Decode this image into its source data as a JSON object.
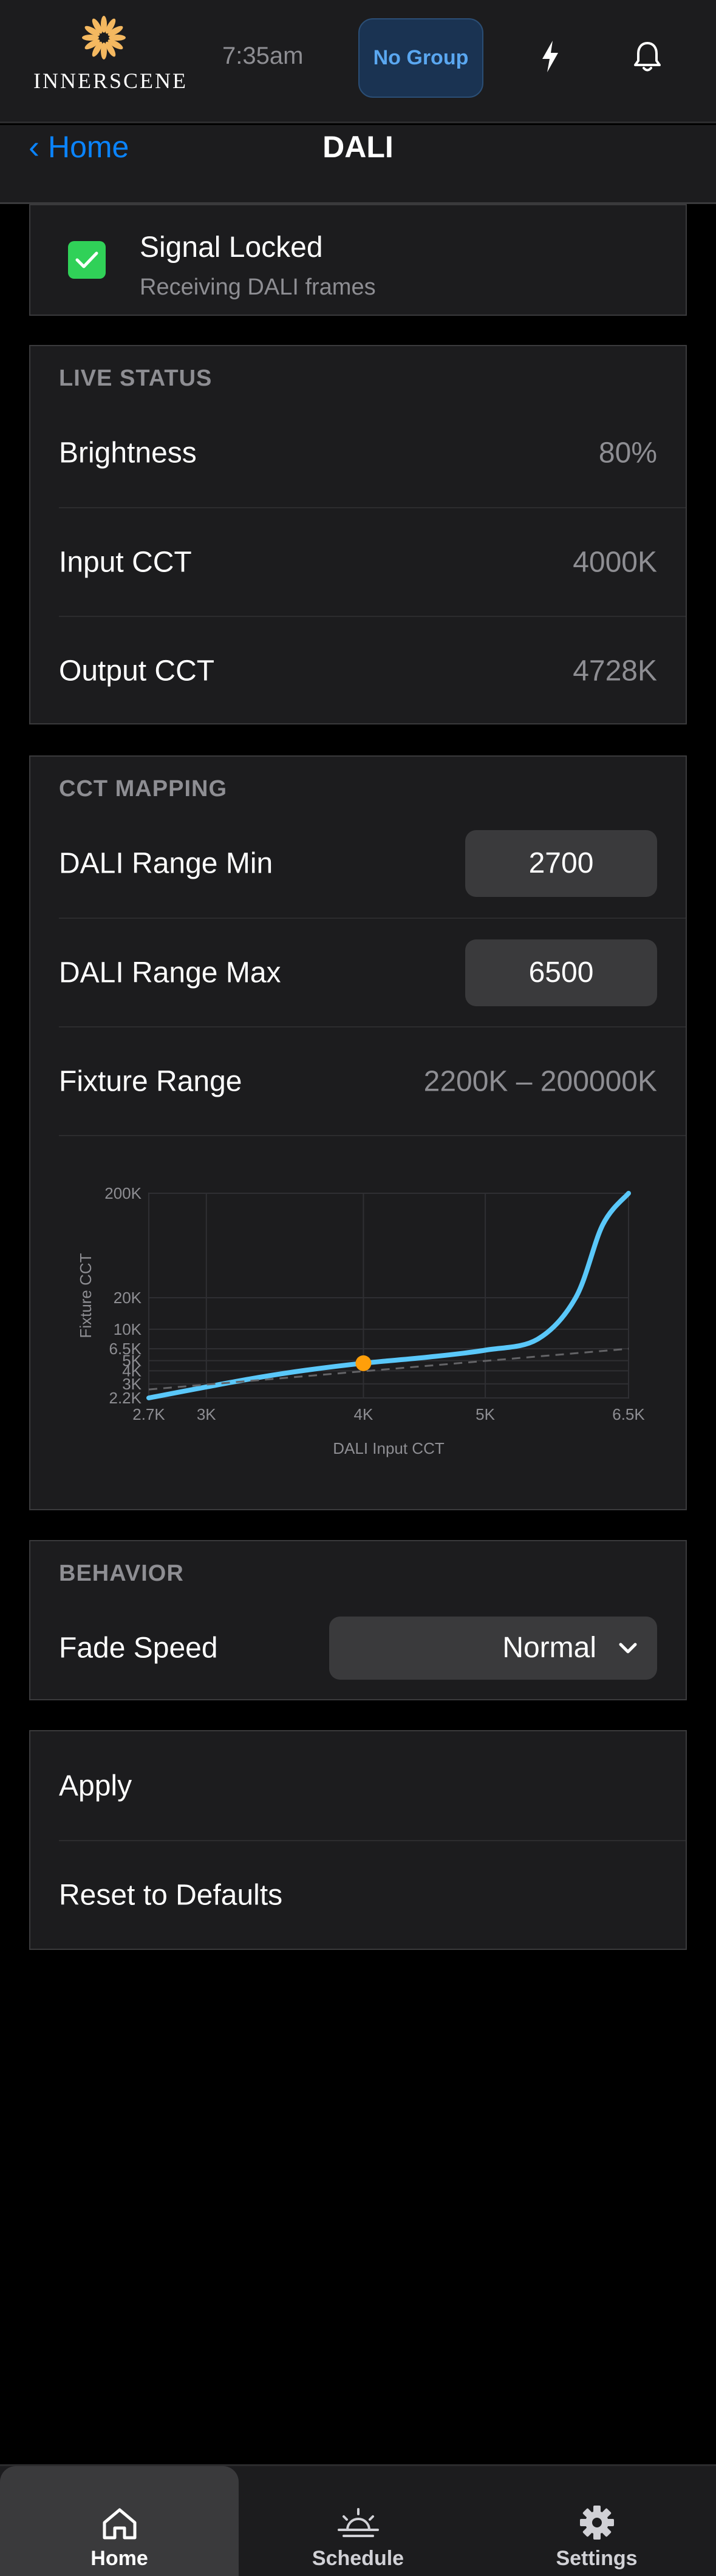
{
  "header": {
    "brand": "INNERSCENE",
    "time": "7:35am",
    "group_button": "No Group"
  },
  "nav": {
    "back_label": "Home",
    "title": "DALI"
  },
  "signal": {
    "title": "Signal Locked",
    "subtitle": "Receiving DALI frames",
    "checked": true
  },
  "live_status": {
    "header": "LIVE STATUS",
    "rows": [
      {
        "label": "Brightness",
        "value": "80%"
      },
      {
        "label": "Input CCT",
        "value": "4000K"
      },
      {
        "label": "Output CCT",
        "value": "4728K"
      }
    ]
  },
  "cct_mapping": {
    "header": "CCT MAPPING",
    "range_min_label": "DALI Range Min",
    "range_min_value": "2700",
    "range_max_label": "DALI Range Max",
    "range_max_value": "6500",
    "fixture_label": "Fixture Range",
    "fixture_value": "2200K – 200000K"
  },
  "chart_data": {
    "type": "line",
    "xlabel": "DALI Input CCT",
    "ylabel": "Fixture CCT",
    "x_ticks": [
      "2.7K",
      "3K",
      "4K",
      "5K",
      "6.5K"
    ],
    "y_ticks": [
      "200K",
      "20K",
      "10K",
      "6.5K",
      "5K",
      "4K",
      "3K",
      "2.2K"
    ],
    "xlim": [
      2700,
      6500
    ],
    "ylim": [
      2200,
      200000
    ],
    "series": [
      {
        "x": [
          2700,
          3000,
          3300,
          3600,
          4000,
          4500,
          5000,
          5500,
          5900,
          6200,
          6500
        ],
        "y": [
          2200,
          2800,
          3450,
          4050,
          4728,
          5400,
          6300,
          8000,
          20000,
          100000,
          200000
        ],
        "color": "#5ac8fa"
      },
      {
        "x": [
          2700,
          6500
        ],
        "y": [
          2650,
          6500
        ],
        "color": "#636366",
        "style": "dashed"
      }
    ],
    "marker": {
      "x": 4000,
      "y": 4728,
      "color": "#ff9f0a"
    }
  },
  "behavior": {
    "header": "BEHAVIOR",
    "fade_label": "Fade Speed",
    "fade_value": "Normal"
  },
  "actions": {
    "apply": "Apply",
    "reset": "Reset to Defaults"
  },
  "tabs": [
    {
      "label": "Home",
      "icon": "home-icon",
      "active": true
    },
    {
      "label": "Schedule",
      "icon": "sunrise-icon",
      "active": false
    },
    {
      "label": "Settings",
      "icon": "gear-icon",
      "active": false
    }
  ],
  "colors": {
    "accent": "#0a84ff",
    "success": "#30d158",
    "curve": "#5ac8fa",
    "marker": "#ff9f0a",
    "card": "#1c1c1e"
  }
}
